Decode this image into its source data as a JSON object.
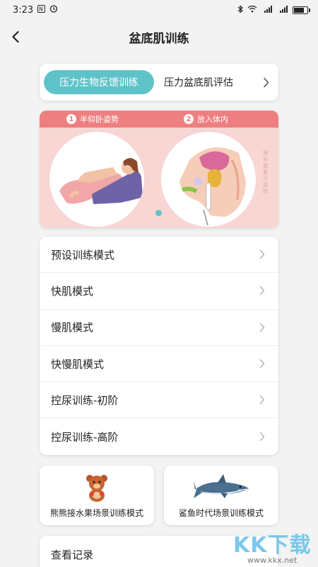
{
  "status_bar": {
    "time": "3:23",
    "battery_level": 0.85,
    "signal_label_1": "⁴ᴳ",
    "signal_label_2": "⁴ᴳ"
  },
  "header": {
    "title": "盆底肌训练"
  },
  "tabs": [
    {
      "label": "压力生物反馈训练",
      "active": true
    },
    {
      "label": "压力盆底肌评估",
      "active": false
    }
  ],
  "banner": {
    "step1_num": "1",
    "step1_label": "半仰卧姿势",
    "step2_num": "2",
    "step2_label": "放入体内",
    "side_label": "探头放置示意图"
  },
  "modes": [
    {
      "label": "预设训练模式"
    },
    {
      "label": "快肌模式"
    },
    {
      "label": "慢肌模式"
    },
    {
      "label": "快慢肌模式"
    },
    {
      "label": "控尿训练-初阶"
    },
    {
      "label": "控尿训练-高阶"
    }
  ],
  "games": [
    {
      "label": "熊熊接水果场景训练模式",
      "icon": "bear-icon"
    },
    {
      "label": "鲨鱼时代场景训练模式",
      "icon": "shark-icon"
    }
  ],
  "record": {
    "label": "查看记录"
  },
  "watermark": {
    "logo": "KK下载",
    "url": "www.kkx.net"
  },
  "colors": {
    "accent": "#5ec3c8",
    "banner_pink": "#f8d6d3",
    "banner_strip": "#ee7f80"
  }
}
